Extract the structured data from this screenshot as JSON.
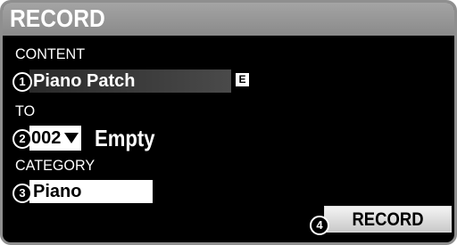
{
  "screen": {
    "title": "RECORD",
    "content": {
      "label": "CONTENT",
      "value": "Piano Patch",
      "badge": "E"
    },
    "to": {
      "label": "TO",
      "number": "002",
      "name": "Empty"
    },
    "category": {
      "label": "CATEGORY",
      "value": "Piano"
    },
    "record_button": "RECORD"
  },
  "callouts": [
    "1",
    "2",
    "3",
    "4"
  ]
}
